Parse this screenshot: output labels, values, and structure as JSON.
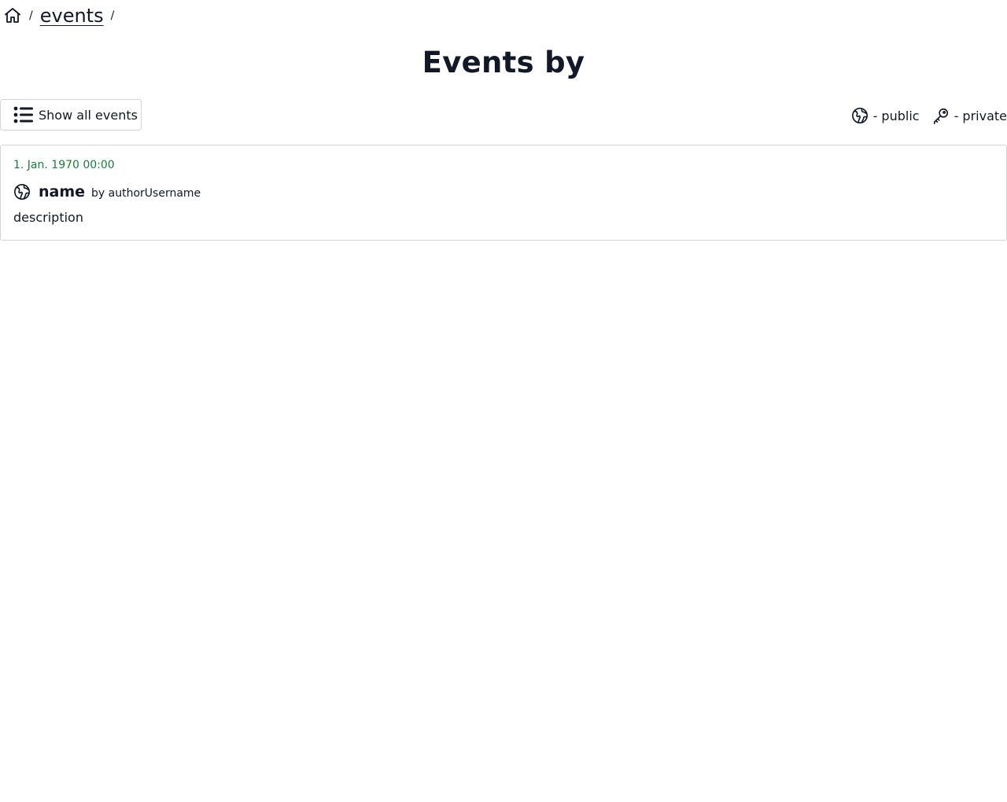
{
  "breadcrumb": {
    "home_icon": "home-icon",
    "separator": "/",
    "items": [
      {
        "label": "events"
      }
    ]
  },
  "title": "Events by",
  "toolbar": {
    "show_all_label": "Show all events",
    "show_all_icon": "list-icon"
  },
  "legend": {
    "public": {
      "icon": "globe-icon",
      "label": "- public"
    },
    "private": {
      "icon": "key-icon",
      "label": "- private"
    }
  },
  "events": [
    {
      "date": "1. Jan. 1970 00:00",
      "visibility": "public",
      "icon": "globe-icon",
      "name": "name",
      "author": "by authorUsername",
      "description": "description"
    }
  ],
  "colors": {
    "text": "#111827",
    "date": "#15803d",
    "border": "#d1d5db",
    "background": "#ffffff"
  }
}
